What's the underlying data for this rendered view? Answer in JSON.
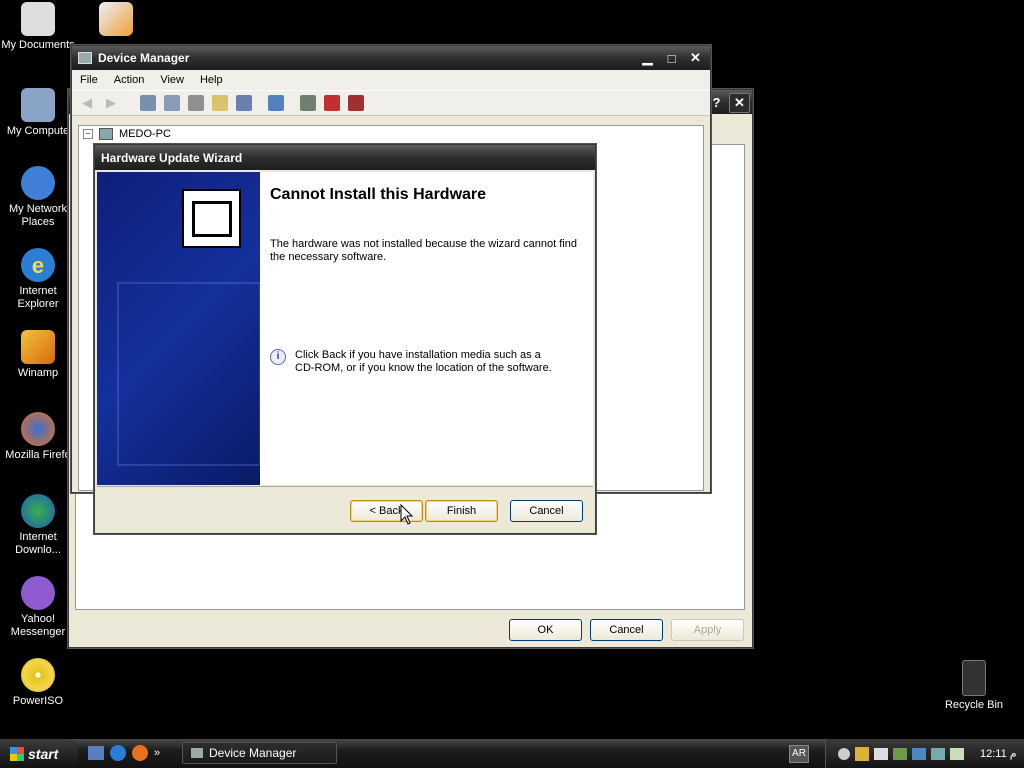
{
  "desktop": {
    "icons": [
      {
        "label": "My Documents"
      },
      {
        "label": "My Compute"
      },
      {
        "label": "My Network Places"
      },
      {
        "label": "Internet Explorer"
      },
      {
        "label": "Winamp"
      },
      {
        "label": "Mozilla Firefo"
      },
      {
        "label": "Internet Downlo..."
      },
      {
        "label": "Yahoo! Messenger"
      },
      {
        "label": "PowerISO"
      },
      {
        "label": "Recycle Bin"
      }
    ]
  },
  "device_manager": {
    "title": "Device Manager",
    "menu": [
      "File",
      "Action",
      "View",
      "Help"
    ],
    "tree_root": "MEDO-PC"
  },
  "properties_dialog": {
    "help_glyph": "?",
    "close_glyph": "✕",
    "ok_label": "OK",
    "cancel_label": "Cancel",
    "apply_label": "Apply"
  },
  "wizard": {
    "title": "Hardware Update Wizard",
    "heading": "Cannot Install this Hardware",
    "message": "The hardware was not installed because the wizard cannot find the necessary software.",
    "info": "Click Back if you have installation media such as a CD-ROM, or if you know the location of the software.",
    "back_label": "< Back",
    "finish_label": "Finish",
    "cancel_label": "Cancel"
  },
  "taskbar": {
    "start_label": "start",
    "task_label": "Device Manager",
    "lang": "AR",
    "clock": "12:11 م",
    "chevron": "»"
  }
}
